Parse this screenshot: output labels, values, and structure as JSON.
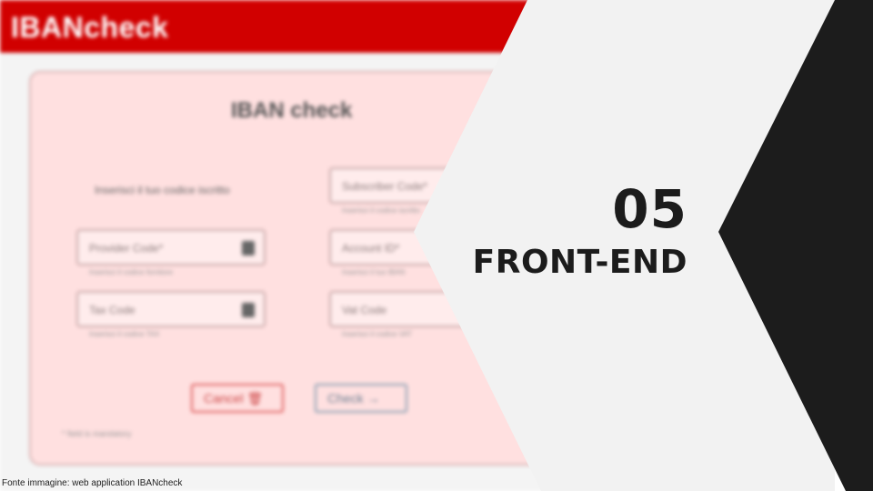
{
  "app": {
    "brand": "IBANcheck",
    "form_title": "IBAN check",
    "prompt": "Inserisci il tuo codice iscritto",
    "fields": [
      {
        "placeholder": "Subscriber Code*",
        "hint": "Inserisci il codice iscritto"
      },
      {
        "placeholder": "Provider Code*",
        "hint": "Inserisci il codice fornitore"
      },
      {
        "placeholder": "Account ID*",
        "hint": "Inserisci il tuo IBAN"
      },
      {
        "placeholder": "Tax Code",
        "hint": "Inserisci il codice TAX"
      },
      {
        "placeholder": "Vat Code",
        "hint": "Inserisci il codice VAT"
      }
    ],
    "cancel_label": "Cancel",
    "check_label": "Check",
    "mandatory_note": "* field is mandatory"
  },
  "slide": {
    "number": "05",
    "title": "FRONT-END"
  },
  "caption": "Fonte immagine: web application IBANcheck",
  "colors": {
    "brand_red": "#d10000",
    "panel_light": "#f2f2f2",
    "panel_dark": "#1c1c1c"
  }
}
